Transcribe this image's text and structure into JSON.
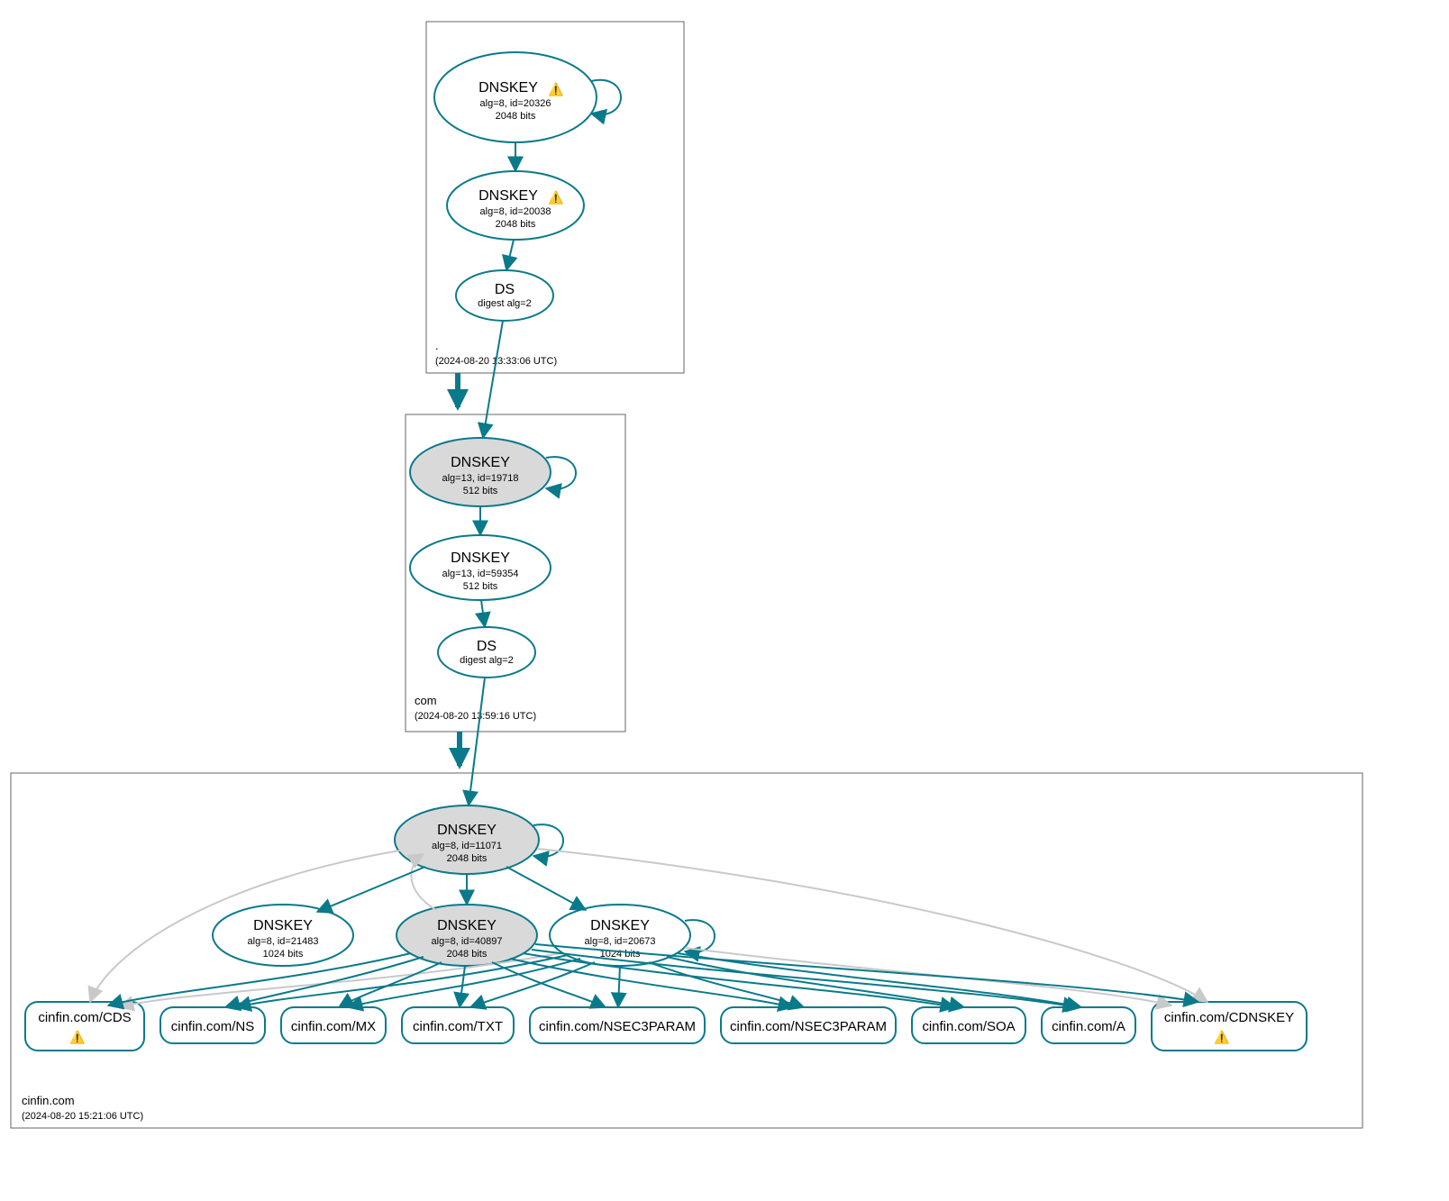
{
  "zones": {
    "root": {
      "label": ".",
      "timestamp": "(2024-08-20 13:33:06 UTC)"
    },
    "com": {
      "label": "com",
      "timestamp": "(2024-08-20 13:59:16 UTC)"
    },
    "cinfin": {
      "label": "cinfin.com",
      "timestamp": "(2024-08-20 15:21:06 UTC)"
    }
  },
  "nodes": {
    "root_ksk": {
      "title": "DNSKEY",
      "line1": "alg=8, id=20326",
      "line2": "2048 bits",
      "warn": true,
      "grey": true,
      "double": true
    },
    "root_zsk": {
      "title": "DNSKEY",
      "line1": "alg=8, id=20038",
      "line2": "2048 bits",
      "warn": true,
      "grey": false,
      "double": false
    },
    "root_ds": {
      "title": "DS",
      "line1": "digest alg=2",
      "line2": "",
      "warn": false,
      "grey": false,
      "double": false
    },
    "com_ksk": {
      "title": "DNSKEY",
      "line1": "alg=13, id=19718",
      "line2": "512 bits",
      "warn": false,
      "grey": true,
      "double": false
    },
    "com_zsk": {
      "title": "DNSKEY",
      "line1": "alg=13, id=59354",
      "line2": "512 bits",
      "warn": false,
      "grey": false,
      "double": false
    },
    "com_ds": {
      "title": "DS",
      "line1": "digest alg=2",
      "line2": "",
      "warn": false,
      "grey": false,
      "double": false
    },
    "cin_ksk": {
      "title": "DNSKEY",
      "line1": "alg=8, id=11071",
      "line2": "2048 bits",
      "warn": false,
      "grey": true,
      "double": false
    },
    "cin_z1": {
      "title": "DNSKEY",
      "line1": "alg=8, id=21483",
      "line2": "1024 bits",
      "warn": false,
      "grey": false,
      "double": false
    },
    "cin_z2": {
      "title": "DNSKEY",
      "line1": "alg=8, id=40897",
      "line2": "2048 bits",
      "warn": false,
      "grey": true,
      "double": false
    },
    "cin_z3": {
      "title": "DNSKEY",
      "line1": "alg=8, id=20673",
      "line2": "1024 bits",
      "warn": false,
      "grey": false,
      "double": false
    }
  },
  "rrsets": {
    "cds": {
      "label": "cinfin.com/CDS",
      "warn": true
    },
    "ns": {
      "label": "cinfin.com/NS",
      "warn": false
    },
    "mx": {
      "label": "cinfin.com/MX",
      "warn": false
    },
    "txt": {
      "label": "cinfin.com/TXT",
      "warn": false
    },
    "nsec3a": {
      "label": "cinfin.com/NSEC3PARAM",
      "warn": false
    },
    "nsec3b": {
      "label": "cinfin.com/NSEC3PARAM",
      "warn": false
    },
    "soa": {
      "label": "cinfin.com/SOA",
      "warn": false
    },
    "a": {
      "label": "cinfin.com/A",
      "warn": false
    },
    "cdnskey": {
      "label": "cinfin.com/CDNSKEY",
      "warn": true
    }
  },
  "icons": {
    "warning": "⚠️"
  }
}
